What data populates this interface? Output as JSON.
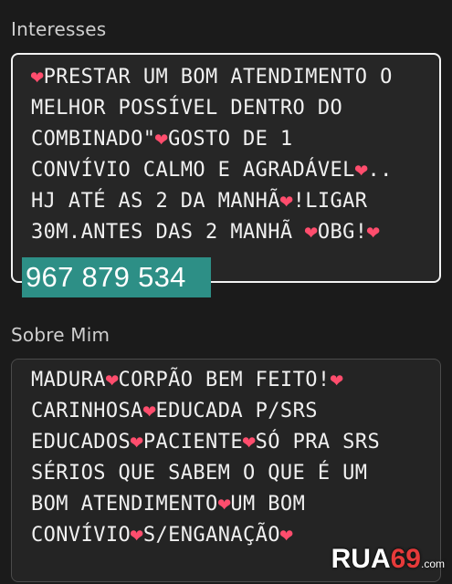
{
  "interests": {
    "label": "Interesses",
    "lines": [
      "❤PRESTAR UM BOM ATENDIMENTO O",
      "MELHOR POSSÍVEL DENTRO DO",
      "COMBINADO\"❤GOSTO DE 1",
      "CONVÍVIO CALMO E AGRADÁVEL❤..",
      "HJ ATÉ AS 2 DA MANHÃ❤!LIGAR",
      "30M.ANTES DAS 2 MANHÃ ❤OBG!❤"
    ],
    "phone": "967 879 534"
  },
  "about": {
    "label": "Sobre Mim",
    "lines": [
      "MADURA❤CORPÃO BEM FEITO!❤",
      "CARINHOSA❤EDUCADA P/SRS",
      "EDUCADOS❤PACIENTE❤SÓ PRA SRS",
      "SÉRIOS QUE SABEM O QUE É UM",
      "BOM ATENDIMENTO❤UM BOM",
      "CONVÍVIO❤S/ENGANAÇÃO❤"
    ]
  },
  "watermark": {
    "main": "RUA",
    "accent": "69",
    "suffix": ".com"
  },
  "colors": {
    "background": "#1b1b1b",
    "box": "#262626",
    "heart": "#ff4d6d",
    "phone_highlight": "#2d8f86"
  }
}
